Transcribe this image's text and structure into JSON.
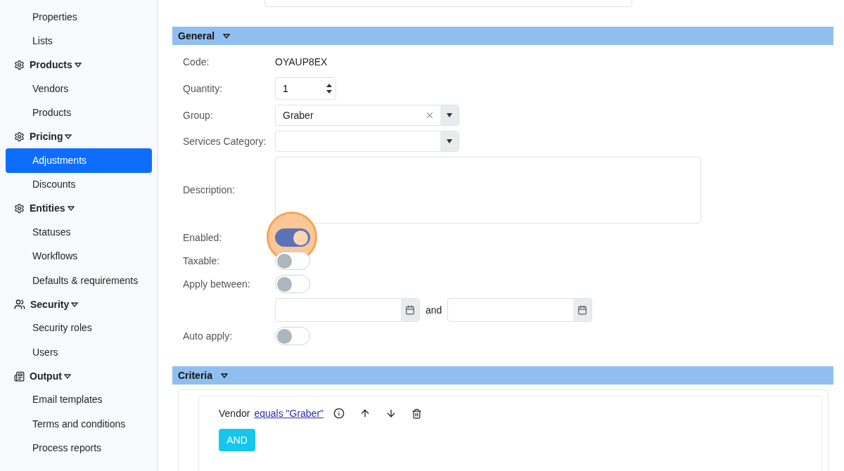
{
  "sidebar": {
    "items": [
      {
        "kind": "item",
        "label": "Properties",
        "selected": false
      },
      {
        "kind": "item",
        "label": "Lists",
        "selected": false
      },
      {
        "kind": "group",
        "label": "Products",
        "children": [
          {
            "label": "Vendors",
            "selected": false
          },
          {
            "label": "Products",
            "selected": false
          }
        ]
      },
      {
        "kind": "group",
        "label": "Pricing",
        "children": [
          {
            "label": "Adjustments",
            "selected": true
          },
          {
            "label": "Discounts",
            "selected": false
          }
        ]
      },
      {
        "kind": "group",
        "label": "Entities",
        "children": [
          {
            "label": "Statuses",
            "selected": false
          },
          {
            "label": "Workflows",
            "selected": false
          },
          {
            "label": "Defaults & requirements",
            "selected": false
          }
        ]
      },
      {
        "kind": "group",
        "label": "Security",
        "children": [
          {
            "label": "Security roles",
            "selected": false
          },
          {
            "label": "Users",
            "selected": false
          }
        ]
      },
      {
        "kind": "group",
        "label": "Output",
        "children": [
          {
            "label": "Email templates",
            "selected": false
          },
          {
            "label": "Terms and conditions",
            "selected": false
          },
          {
            "label": "Process reports",
            "selected": false
          }
        ]
      }
    ]
  },
  "general": {
    "title": "General",
    "fields": [
      {
        "kind": "static",
        "label": "Code:",
        "value": "OYAUP8EX"
      },
      {
        "kind": "number",
        "label": "Quantity:",
        "value": "1"
      },
      {
        "kind": "select",
        "label": "Group:",
        "value": "Graber",
        "clearable": true
      },
      {
        "kind": "select",
        "label": "Services Category:",
        "clearable": false
      },
      {
        "kind": "textarea",
        "label": "Description:"
      },
      {
        "kind": "toggle",
        "label": "Enabled:",
        "on": true,
        "highlighted": true
      },
      {
        "kind": "toggle",
        "label": "Taxable:",
        "on": false,
        "highlighted": false
      },
      {
        "kind": "toggle",
        "label": "Apply between:",
        "on": false,
        "highlighted": false
      },
      {
        "kind": "date_range",
        "separator": "and"
      },
      {
        "kind": "toggle",
        "label": "Auto apply:",
        "on": false,
        "highlighted": false
      }
    ]
  },
  "criteria": {
    "title": "Criteria",
    "rule": {
      "field": "Vendor",
      "condition": "equals \"Graber\""
    },
    "button": "AND"
  }
}
